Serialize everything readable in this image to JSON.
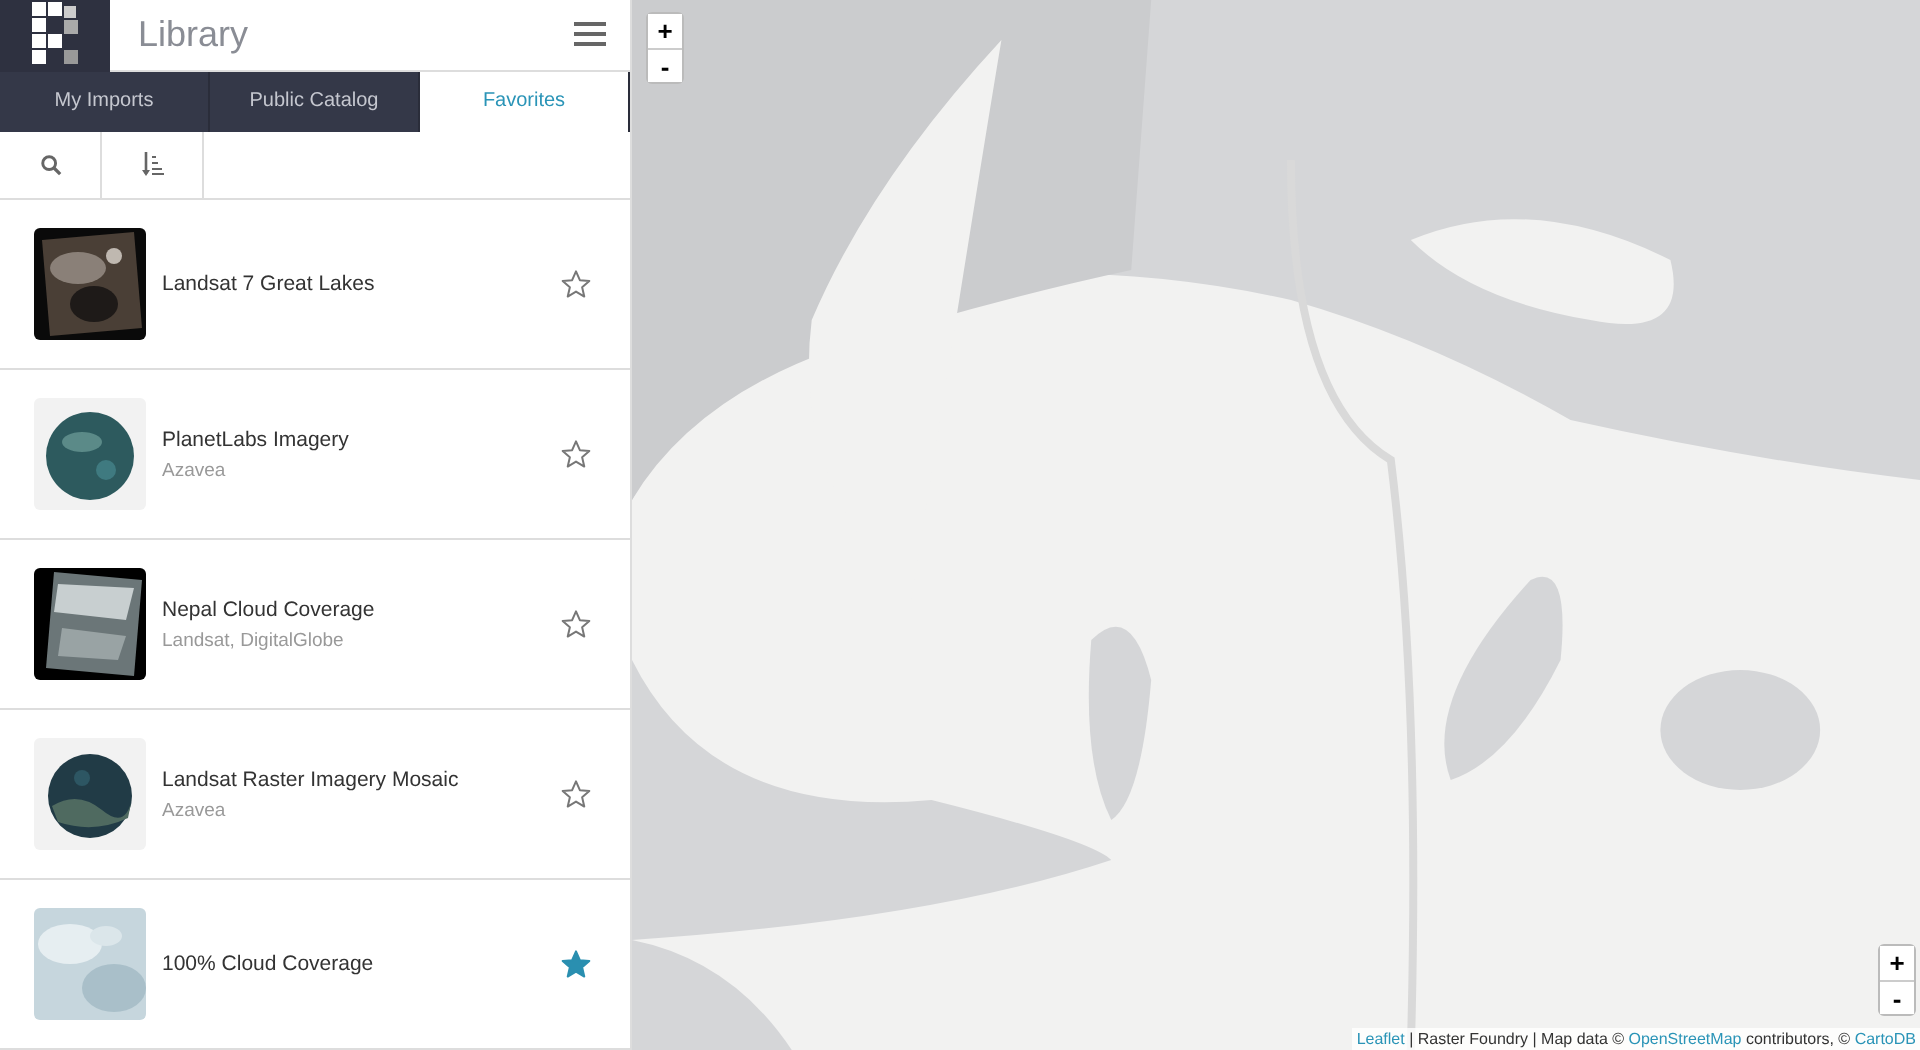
{
  "header": {
    "title": "Library"
  },
  "tabs": [
    {
      "label": "My Imports",
      "selected": false
    },
    {
      "label": "Public Catalog",
      "selected": false
    },
    {
      "label": "Favorites",
      "selected": true
    }
  ],
  "items": [
    {
      "title": "Landsat 7 Great Lakes",
      "favorite": false
    },
    {
      "title": "PlanetLabs Imagery",
      "subtitle": "Azavea",
      "favorite": false
    },
    {
      "title": "Nepal Cloud Coverage",
      "subtitle": "Landsat, DigitalGlobe",
      "favorite": false
    },
    {
      "title": "Landsat Raster Imagery Mosaic",
      "subtitle": "Azavea",
      "favorite": false
    },
    {
      "title": "100% Cloud Coverage",
      "favorite": true
    }
  ],
  "map": {
    "zoom_top": [
      "+",
      "-"
    ],
    "zoom_bottom": [
      "+",
      "-"
    ],
    "attribution": [
      {
        "kind": "link",
        "text": "Leaflet"
      },
      {
        "kind": "text",
        "text": " | Raster Foundry | Map data © "
      },
      {
        "kind": "link",
        "text": "OpenStreetMap"
      },
      {
        "kind": "text",
        "text": " contributors, © "
      },
      {
        "kind": "link",
        "text": "CartoDB"
      }
    ]
  }
}
